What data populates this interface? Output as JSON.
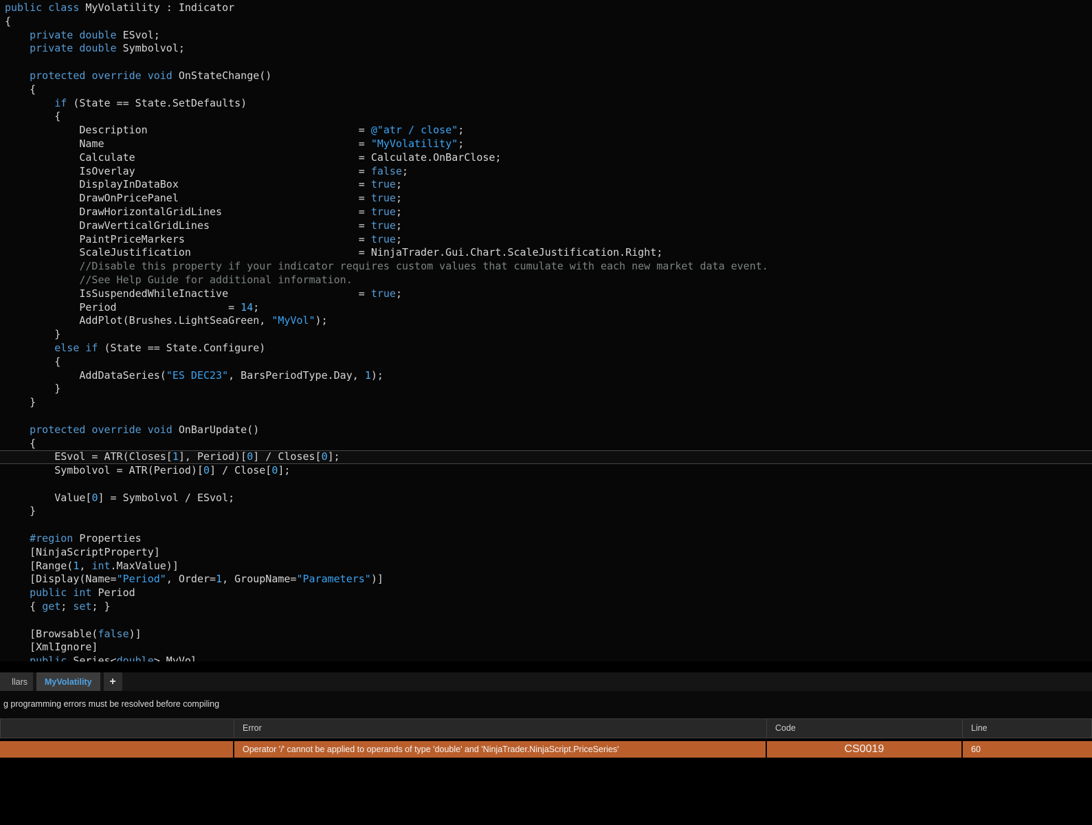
{
  "colors": {
    "code_background": "#070707",
    "keyword": "#569CD6",
    "string": "#3BA3F2",
    "number": "#4FB0F6",
    "comment": "#7C8382",
    "active_tab_text": "#4FA3E6",
    "error_row_background": "#BA5F2C"
  },
  "editor": {
    "current_line_index": 33,
    "lines": [
      [
        [
          "k",
          "public"
        ],
        [
          "p",
          " "
        ],
        [
          "k",
          "class"
        ],
        [
          "p",
          " MyVolatility : Indicator"
        ]
      ],
      [
        [
          "p",
          "{"
        ]
      ],
      [
        [
          "p",
          "    "
        ],
        [
          "k",
          "private"
        ],
        [
          "p",
          " "
        ],
        [
          "k",
          "double"
        ],
        [
          "p",
          " ESvol;"
        ]
      ],
      [
        [
          "p",
          "    "
        ],
        [
          "k",
          "private"
        ],
        [
          "p",
          " "
        ],
        [
          "k",
          "double"
        ],
        [
          "p",
          " Symbolvol;"
        ]
      ],
      [],
      [
        [
          "p",
          "    "
        ],
        [
          "k",
          "protected"
        ],
        [
          "p",
          " "
        ],
        [
          "k",
          "override"
        ],
        [
          "p",
          " "
        ],
        [
          "k",
          "void"
        ],
        [
          "p",
          " OnStateChange()"
        ]
      ],
      [
        [
          "p",
          "    {"
        ]
      ],
      [
        [
          "p",
          "        "
        ],
        [
          "k",
          "if"
        ],
        [
          "p",
          " (State == State.SetDefaults)"
        ]
      ],
      [
        [
          "p",
          "        {"
        ]
      ],
      [
        [
          "p",
          "            Description                                  = "
        ],
        [
          "s",
          "@\"atr / close\""
        ],
        [
          "p",
          ";"
        ]
      ],
      [
        [
          "p",
          "            Name                                         = "
        ],
        [
          "s",
          "\"MyVolatility\""
        ],
        [
          "p",
          ";"
        ]
      ],
      [
        [
          "p",
          "            Calculate                                    = Calculate.OnBarClose;"
        ]
      ],
      [
        [
          "p",
          "            IsOverlay                                    = "
        ],
        [
          "k",
          "false"
        ],
        [
          "p",
          ";"
        ]
      ],
      [
        [
          "p",
          "            DisplayInDataBox                             = "
        ],
        [
          "k",
          "true"
        ],
        [
          "p",
          ";"
        ]
      ],
      [
        [
          "p",
          "            DrawOnPricePanel                             = "
        ],
        [
          "k",
          "true"
        ],
        [
          "p",
          ";"
        ]
      ],
      [
        [
          "p",
          "            DrawHorizontalGridLines                      = "
        ],
        [
          "k",
          "true"
        ],
        [
          "p",
          ";"
        ]
      ],
      [
        [
          "p",
          "            DrawVerticalGridLines                        = "
        ],
        [
          "k",
          "true"
        ],
        [
          "p",
          ";"
        ]
      ],
      [
        [
          "p",
          "            PaintPriceMarkers                            = "
        ],
        [
          "k",
          "true"
        ],
        [
          "p",
          ";"
        ]
      ],
      [
        [
          "p",
          "            ScaleJustification                           = NinjaTrader.Gui.Chart.ScaleJustification.Right;"
        ]
      ],
      [
        [
          "p",
          "            "
        ],
        [
          "c",
          "//Disable this property if your indicator requires custom values that cumulate with each new market data event."
        ]
      ],
      [
        [
          "p",
          "            "
        ],
        [
          "c",
          "//See Help Guide for additional information."
        ]
      ],
      [
        [
          "p",
          "            IsSuspendedWhileInactive                     = "
        ],
        [
          "k",
          "true"
        ],
        [
          "p",
          ";"
        ]
      ],
      [
        [
          "p",
          "            Period                  = "
        ],
        [
          "n",
          "14"
        ],
        [
          "p",
          ";"
        ]
      ],
      [
        [
          "p",
          "            AddPlot(Brushes.LightSeaGreen, "
        ],
        [
          "s",
          "\"MyVol\""
        ],
        [
          "p",
          ");"
        ]
      ],
      [
        [
          "p",
          "        }"
        ]
      ],
      [
        [
          "p",
          "        "
        ],
        [
          "k",
          "else"
        ],
        [
          "p",
          " "
        ],
        [
          "k",
          "if"
        ],
        [
          "p",
          " (State == State.Configure)"
        ]
      ],
      [
        [
          "p",
          "        {"
        ]
      ],
      [
        [
          "p",
          "            AddDataSeries("
        ],
        [
          "s",
          "\"ES DEC23\""
        ],
        [
          "p",
          ", BarsPeriodType.Day, "
        ],
        [
          "n",
          "1"
        ],
        [
          "p",
          ");"
        ]
      ],
      [
        [
          "p",
          "        }"
        ]
      ],
      [
        [
          "p",
          "    }"
        ]
      ],
      [],
      [
        [
          "p",
          "    "
        ],
        [
          "k",
          "protected"
        ],
        [
          "p",
          " "
        ],
        [
          "k",
          "override"
        ],
        [
          "p",
          " "
        ],
        [
          "k",
          "void"
        ],
        [
          "p",
          " OnBarUpdate()"
        ]
      ],
      [
        [
          "p",
          "    {"
        ]
      ],
      [
        [
          "p",
          "        ESvol = ATR(Closes["
        ],
        [
          "n",
          "1"
        ],
        [
          "p",
          "], Period)["
        ],
        [
          "n",
          "0"
        ],
        [
          "p",
          "] / Closes["
        ],
        [
          "n",
          "0"
        ],
        [
          "p",
          "];"
        ]
      ],
      [
        [
          "p",
          "        Symbolvol = ATR(Period)["
        ],
        [
          "n",
          "0"
        ],
        [
          "p",
          "] / Close["
        ],
        [
          "n",
          "0"
        ],
        [
          "p",
          "];"
        ]
      ],
      [],
      [
        [
          "p",
          "        Value["
        ],
        [
          "n",
          "0"
        ],
        [
          "p",
          "] = Symbolvol / ESvol;"
        ]
      ],
      [
        [
          "p",
          "    }"
        ]
      ],
      [],
      [
        [
          "p",
          "    "
        ],
        [
          "k",
          "#region"
        ],
        [
          "p",
          " Properties"
        ]
      ],
      [
        [
          "p",
          "    [NinjaScriptProperty]"
        ]
      ],
      [
        [
          "p",
          "    [Range("
        ],
        [
          "n",
          "1"
        ],
        [
          "p",
          ", "
        ],
        [
          "k",
          "int"
        ],
        [
          "p",
          ".MaxValue)]"
        ]
      ],
      [
        [
          "p",
          "    [Display(Name="
        ],
        [
          "s",
          "\"Period\""
        ],
        [
          "p",
          ", Order="
        ],
        [
          "n",
          "1"
        ],
        [
          "p",
          ", GroupName="
        ],
        [
          "s",
          "\"Parameters\""
        ],
        [
          "p",
          ")]"
        ]
      ],
      [
        [
          "p",
          "    "
        ],
        [
          "k",
          "public"
        ],
        [
          "p",
          " "
        ],
        [
          "k",
          "int"
        ],
        [
          "p",
          " Period"
        ]
      ],
      [
        [
          "p",
          "    { "
        ],
        [
          "k",
          "get"
        ],
        [
          "p",
          "; "
        ],
        [
          "k",
          "set"
        ],
        [
          "p",
          "; }"
        ]
      ],
      [],
      [
        [
          "p",
          "    [Browsable("
        ],
        [
          "k",
          "false"
        ],
        [
          "p",
          ")]"
        ]
      ],
      [
        [
          "p",
          "    [XmlIgnore]"
        ]
      ],
      [
        [
          "p",
          "    "
        ],
        [
          "k",
          "public"
        ],
        [
          "p",
          " Series<"
        ],
        [
          "k",
          "double"
        ],
        [
          "p",
          "> MyVol"
        ]
      ]
    ]
  },
  "tabs": {
    "items": [
      {
        "label": "llars",
        "active": false
      },
      {
        "label": "MyVolatility",
        "active": true
      }
    ],
    "add_label": "+"
  },
  "status": {
    "message": "g programming errors must be resolved before compiling"
  },
  "error_table": {
    "columns": [
      "",
      "Error",
      "Code",
      "Line"
    ],
    "rows": [
      {
        "error": "Operator '/' cannot be applied to operands of type 'double' and 'NinjaTrader.NinjaScript.PriceSeries'",
        "code": "CS0019",
        "line": "60"
      }
    ]
  }
}
